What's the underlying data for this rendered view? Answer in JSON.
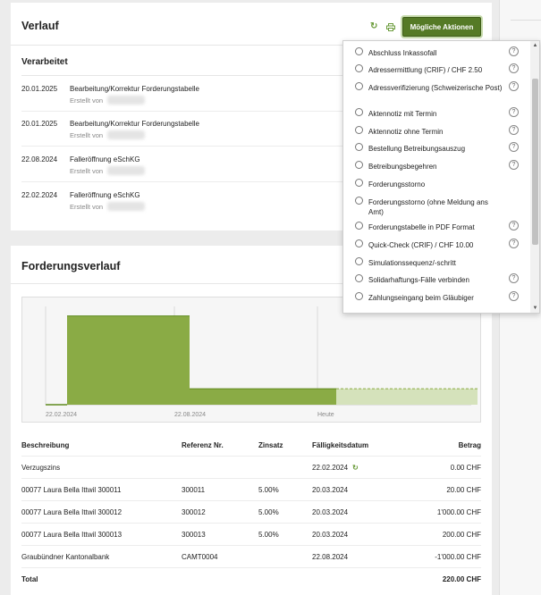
{
  "verlauf": {
    "title": "Verlauf",
    "subtitle": "Verarbeitet",
    "actions_button": "Mögliche Aktionen",
    "entries": [
      {
        "date": "20.01.2025",
        "title": "Bearbeitung/Korrektur Forderungstabelle",
        "by": "Erstellt von"
      },
      {
        "date": "20.01.2025",
        "title": "Bearbeitung/Korrektur Forderungstabelle",
        "by": "Erstellt von"
      },
      {
        "date": "22.08.2024",
        "title": "Falleröffnung eSchKG",
        "by": "Erstellt von"
      },
      {
        "date": "22.02.2024",
        "title": "Falleröffnung eSchKG",
        "by": "Erstellt von"
      }
    ]
  },
  "forderungsverlauf": {
    "title": "Forderungsverlauf",
    "chart_data": {
      "type": "area",
      "x_labels": [
        "22.02.2024",
        "22.08.2024",
        "Heute"
      ],
      "series": [
        {
          "segments": [
            {
              "from": "22.02.2024",
              "to": "22.08.2024",
              "value": 1220,
              "style": "solid"
            },
            {
              "from": "22.08.2024",
              "to": "Heute",
              "value": 220,
              "style": "solid"
            },
            {
              "from": "Heute",
              "to": "end",
              "value": 220,
              "style": "projected"
            }
          ]
        }
      ],
      "grid": true,
      "colors": {
        "solid": "#8aab45",
        "solid_stroke": "#5f8a1f",
        "projected": "#d5e2bb",
        "projected_stroke": "#8aab45"
      }
    },
    "table": {
      "headers": [
        "Beschreibung",
        "Referenz Nr.",
        "Zinsatz",
        "Fälligkeitsdatum",
        "Betrag"
      ],
      "rows": [
        {
          "beschreibung": "Verzugszins",
          "referenz": "",
          "zinsatz": "",
          "datum": "22.02.2024",
          "betrag": "0.00 CHF"
        },
        {
          "beschreibung": "00077 Laura Bella Ittwil 300011",
          "referenz": "300011",
          "zinsatz": "5.00%",
          "datum": "20.03.2024",
          "betrag": "20.00 CHF"
        },
        {
          "beschreibung": "00077 Laura Bella Ittwil 300012",
          "referenz": "300012",
          "zinsatz": "5.00%",
          "datum": "20.03.2024",
          "betrag": "1'000.00 CHF"
        },
        {
          "beschreibung": "00077 Laura Bella Ittwil 300013",
          "referenz": "300013",
          "zinsatz": "5.00%",
          "datum": "20.03.2024",
          "betrag": "200.00 CHF"
        },
        {
          "beschreibung": "Graubündner Kantonalbank",
          "referenz": "CAMT0004",
          "zinsatz": "",
          "datum": "22.08.2024",
          "betrag": "-1'000.00 CHF"
        }
      ],
      "total": {
        "label": "Total",
        "betrag": "220.00 CHF"
      }
    }
  },
  "actions_dropdown": {
    "items": [
      {
        "label": "Abschluss Inkassofall",
        "help": true
      },
      {
        "label": "Adressermittlung (CRIF) / CHF 2.50",
        "help": true
      },
      {
        "label": "Adressverifizierung (Schweizerische Post)",
        "help": true
      },
      {
        "label": "Aktennotiz mit Termin",
        "help": true
      },
      {
        "label": "Aktennotiz ohne Termin",
        "help": true
      },
      {
        "label": "Bestellung Betreibungsauszug",
        "help": true
      },
      {
        "label": "Betreibungsbegehren",
        "help": true
      },
      {
        "label": "Forderungsstorno",
        "help": false
      },
      {
        "label": "Forderungsstorno (ohne Meldung ans Amt)",
        "help": false
      },
      {
        "label": "Forderungstabelle in PDF Format",
        "help": true
      },
      {
        "label": "Quick-Check (CRIF) / CHF 10.00",
        "help": true
      },
      {
        "label": "Simulationssequenz/-schritt",
        "help": false
      },
      {
        "label": "Solidarhaftungs-Fälle verbinden",
        "help": true
      },
      {
        "label": "Zahlungseingang beim Gläubiger",
        "help": true
      }
    ],
    "help_glyph": "?"
  },
  "icons": {
    "refresh": "refresh-icon",
    "print": "printer-icon",
    "accent": "#557a26"
  }
}
